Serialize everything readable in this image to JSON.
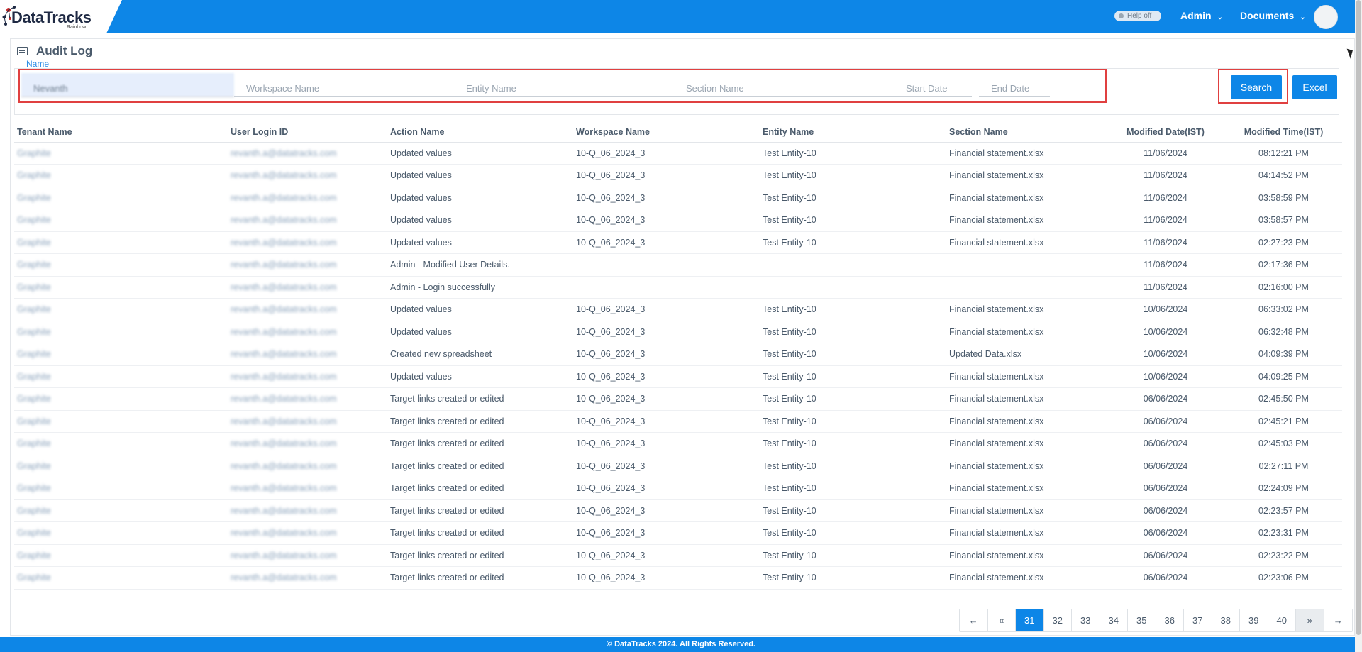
{
  "app": {
    "logo_text": "DataTracks",
    "logo_sub": "Rainbow"
  },
  "header": {
    "help_label": "Help off",
    "admin_label": "Admin",
    "documents_label": "Documents"
  },
  "page": {
    "title": "Audit Log",
    "name_label": "Name"
  },
  "filters": {
    "name_value": "Nevanth",
    "workspace_placeholder": "Workspace Name",
    "entity_placeholder": "Entity Name",
    "section_placeholder": "Section Name",
    "start_placeholder": "Start Date",
    "end_placeholder": "End Date",
    "search_label": "Search",
    "excel_label": "Excel"
  },
  "table": {
    "headers": [
      "Tenant Name",
      "User Login ID",
      "Action Name",
      "Workspace Name",
      "Entity Name",
      "Section Name",
      "Modified Date(IST)",
      "Modified Time(IST)"
    ],
    "rows": [
      [
        "Graphite",
        "revanth.a@datatracks.com",
        "Updated values",
        "10-Q_06_2024_3",
        "Test Entity-10",
        "Financial statement.xlsx",
        "11/06/2024",
        "08:12:21 PM"
      ],
      [
        "Graphite",
        "revanth.a@datatracks.com",
        "Updated values",
        "10-Q_06_2024_3",
        "Test Entity-10",
        "Financial statement.xlsx",
        "11/06/2024",
        "04:14:52 PM"
      ],
      [
        "Graphite",
        "revanth.a@datatracks.com",
        "Updated values",
        "10-Q_06_2024_3",
        "Test Entity-10",
        "Financial statement.xlsx",
        "11/06/2024",
        "03:58:59 PM"
      ],
      [
        "Graphite",
        "revanth.a@datatracks.com",
        "Updated values",
        "10-Q_06_2024_3",
        "Test Entity-10",
        "Financial statement.xlsx",
        "11/06/2024",
        "03:58:57 PM"
      ],
      [
        "Graphite",
        "revanth.a@datatracks.com",
        "Updated values",
        "10-Q_06_2024_3",
        "Test Entity-10",
        "Financial statement.xlsx",
        "11/06/2024",
        "02:27:23 PM"
      ],
      [
        "Graphite",
        "revanth.a@datatracks.com",
        "Admin - Modified User Details.",
        "",
        "",
        "",
        "11/06/2024",
        "02:17:36 PM"
      ],
      [
        "Graphite",
        "revanth.a@datatracks.com",
        "Admin - Login successfully",
        "",
        "",
        "",
        "11/06/2024",
        "02:16:00 PM"
      ],
      [
        "Graphite",
        "revanth.a@datatracks.com",
        "Updated values",
        "10-Q_06_2024_3",
        "Test Entity-10",
        "Financial statement.xlsx",
        "10/06/2024",
        "06:33:02 PM"
      ],
      [
        "Graphite",
        "revanth.a@datatracks.com",
        "Updated values",
        "10-Q_06_2024_3",
        "Test Entity-10",
        "Financial statement.xlsx",
        "10/06/2024",
        "06:32:48 PM"
      ],
      [
        "Graphite",
        "revanth.a@datatracks.com",
        "Created new spreadsheet",
        "10-Q_06_2024_3",
        "Test Entity-10",
        "Updated Data.xlsx",
        "10/06/2024",
        "04:09:39 PM"
      ],
      [
        "Graphite",
        "revanth.a@datatracks.com",
        "Updated values",
        "10-Q_06_2024_3",
        "Test Entity-10",
        "Financial statement.xlsx",
        "10/06/2024",
        "04:09:25 PM"
      ],
      [
        "Graphite",
        "revanth.a@datatracks.com",
        "Target links created or edited",
        "10-Q_06_2024_3",
        "Test Entity-10",
        "Financial statement.xlsx",
        "06/06/2024",
        "02:45:50 PM"
      ],
      [
        "Graphite",
        "revanth.a@datatracks.com",
        "Target links created or edited",
        "10-Q_06_2024_3",
        "Test Entity-10",
        "Financial statement.xlsx",
        "06/06/2024",
        "02:45:21 PM"
      ],
      [
        "Graphite",
        "revanth.a@datatracks.com",
        "Target links created or edited",
        "10-Q_06_2024_3",
        "Test Entity-10",
        "Financial statement.xlsx",
        "06/06/2024",
        "02:45:03 PM"
      ],
      [
        "Graphite",
        "revanth.a@datatracks.com",
        "Target links created or edited",
        "10-Q_06_2024_3",
        "Test Entity-10",
        "Financial statement.xlsx",
        "06/06/2024",
        "02:27:11 PM"
      ],
      [
        "Graphite",
        "revanth.a@datatracks.com",
        "Target links created or edited",
        "10-Q_06_2024_3",
        "Test Entity-10",
        "Financial statement.xlsx",
        "06/06/2024",
        "02:24:09 PM"
      ],
      [
        "Graphite",
        "revanth.a@datatracks.com",
        "Target links created or edited",
        "10-Q_06_2024_3",
        "Test Entity-10",
        "Financial statement.xlsx",
        "06/06/2024",
        "02:23:57 PM"
      ],
      [
        "Graphite",
        "revanth.a@datatracks.com",
        "Target links created or edited",
        "10-Q_06_2024_3",
        "Test Entity-10",
        "Financial statement.xlsx",
        "06/06/2024",
        "02:23:31 PM"
      ],
      [
        "Graphite",
        "revanth.a@datatracks.com",
        "Target links created or edited",
        "10-Q_06_2024_3",
        "Test Entity-10",
        "Financial statement.xlsx",
        "06/06/2024",
        "02:23:22 PM"
      ],
      [
        "Graphite",
        "revanth.a@datatracks.com",
        "Target links created or edited",
        "10-Q_06_2024_3",
        "Test Entity-10",
        "Financial statement.xlsx",
        "06/06/2024",
        "02:23:06 PM"
      ]
    ]
  },
  "pagination": {
    "prev": "←",
    "first": "«",
    "pages": [
      "31",
      "32",
      "33",
      "34",
      "35",
      "36",
      "37",
      "38",
      "39",
      "40"
    ],
    "active_page": "31",
    "last": "»",
    "next": "→"
  },
  "footer": {
    "text": "© DataTracks 2024. All Rights Reserved."
  },
  "colors": {
    "brand": "#0d86e7",
    "highlight": "#e04040"
  }
}
